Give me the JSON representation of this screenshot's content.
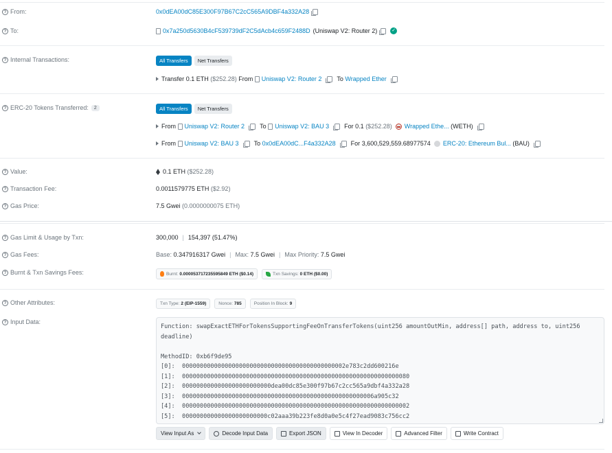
{
  "from": {
    "label": "From:",
    "address": "0x0dEA00dC85E300F97B67C2cC565A9DBF4a332A28"
  },
  "to": {
    "label": "To:",
    "address": "0x7a250d5630B4cF539739dF2C5dAcb4c659F2488D",
    "name": "(Uniswap V2: Router 2)"
  },
  "internal": {
    "label": "Internal Transactions:",
    "tabs": [
      "All Transfers",
      "Net Transfers"
    ],
    "transfer": {
      "prefix": "Transfer",
      "amount": "0.1 ETH",
      "usd": "($252.28)",
      "from_word": "From",
      "from_name": "Uniswap V2: Router 2",
      "to_word": "To",
      "to_name": "Wrapped Ether"
    }
  },
  "erc20": {
    "label": "ERC-20 Tokens Transferred:",
    "count": "2",
    "tabs": [
      "All Transfers",
      "Net Transfers"
    ],
    "rows": [
      {
        "from_word": "From",
        "from_name": "Uniswap V2: Router 2",
        "to_word": "To",
        "to_name": "Uniswap V2: BAU 3",
        "for_word": "For",
        "amount": "0.1",
        "usd": "($252.28)",
        "token": "Wrapped Ethe...",
        "symbol": "(WETH)"
      },
      {
        "from_word": "From",
        "from_name": "Uniswap V2: BAU 3",
        "to_word": "To",
        "to_name": "0x0dEA00dC...F4a332A28",
        "for_word": "For",
        "amount": "3,600,529,559.68977574",
        "usd": "",
        "token": "ERC-20: Ethereum Bul...",
        "symbol": "(BAU)"
      }
    ]
  },
  "value": {
    "label": "Value:",
    "amount": "0.1 ETH",
    "usd": "($252.28)"
  },
  "fee": {
    "label": "Transaction Fee:",
    "amount": "0.0011579775 ETH",
    "usd": "($2.92)"
  },
  "gas_price": {
    "label": "Gas Price:",
    "amount": "7.5 Gwei",
    "detail": "(0.0000000075 ETH)"
  },
  "gas_limit": {
    "label": "Gas Limit & Usage by Txn:",
    "limit": "300,000",
    "usage": "154,397 (51.47%)"
  },
  "gas_fees": {
    "label": "Gas Fees:",
    "base_label": "Base:",
    "base": "0.347916317 Gwei",
    "max_label": "Max:",
    "max": "7.5 Gwei",
    "priority_label": "Max Priority:",
    "priority": "7.5 Gwei"
  },
  "burnt": {
    "label": "Burnt & Txn Savings Fees:",
    "burnt_label": "Burnt:",
    "burnt_value": "0.000053717235595849 ETH ($0.14)",
    "savings_label": "Txn Savings:",
    "savings_value": "0 ETH ($0.00)"
  },
  "other": {
    "label": "Other Attributes:",
    "txn_type_label": "Txn Type:",
    "txn_type": "2 (EIP-1559)",
    "nonce_label": "Nonce:",
    "nonce": "785",
    "position_label": "Position In Block:",
    "position": "9"
  },
  "input": {
    "label": "Input Data:",
    "text": "Function: swapExactETHForTokensSupportingFeeOnTransferTokens(uint256 amountOutMin, address[] path, address to, uint256\ndeadline)\n\nMethodID: 0xb6f9de95\n[0]:  0000000000000000000000000000000000000000000002e783c2dd600216e\n[1]:  0000000000000000000000000000000000000000000000000000000000000080\n[2]:  0000000000000000000000000dea00dc85e300f97b67c2cc565a9dbf4a332a28\n[3]:  000000000000000000000000000000000000000000000000000006a905c32\n[4]:  0000000000000000000000000000000000000000000000000000000000000002\n[5]:  000000000000000000000000c02aaa39b223fe8d0a0e5c4f27ead9083c756cc2",
    "buttons": {
      "view_input": "View Input As",
      "decode": "Decode Input Data",
      "export": "Export JSON",
      "view_decoder": "View In Decoder",
      "advanced_filter": "Advanced Filter",
      "write_contract": "Write Contract"
    }
  }
}
